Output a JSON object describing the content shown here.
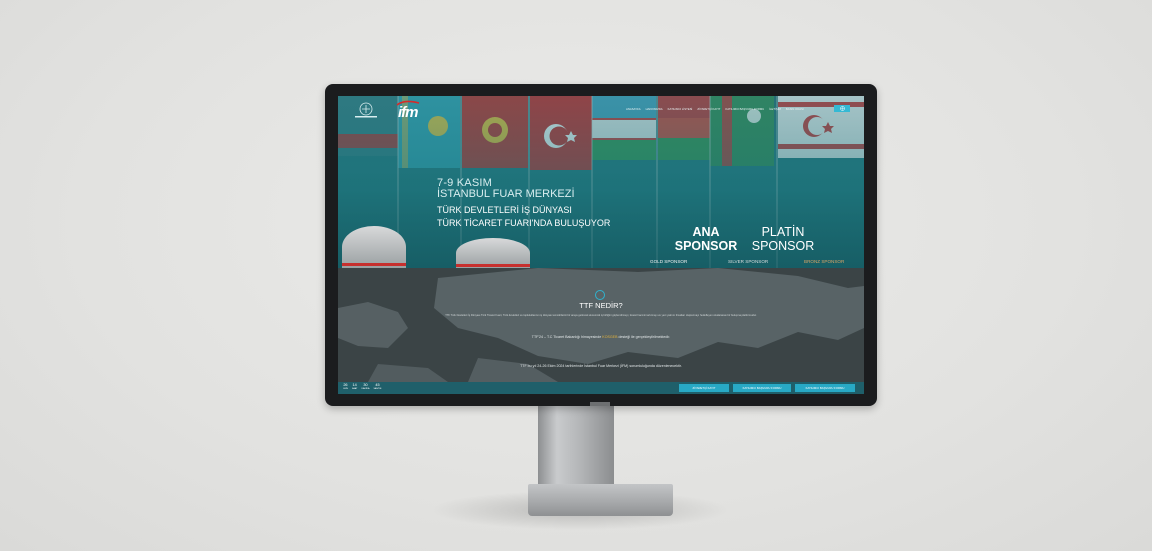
{
  "colors": {
    "background": "#e3e3e1",
    "bezel": "#1b1c1e",
    "hero_teal": "#2b7b82",
    "accent_cyan": "#28a9c5",
    "map_bg": "#3b4446",
    "highlight_gold": "#e3b23c"
  },
  "header": {
    "logo_ttf": "TTF",
    "logo_ifm": "ifm",
    "nav_links": [
      "ANASAYFA",
      "HAKKIMIZDA",
      "KATILIMCI LİSTESİ",
      "ZİYARETÇİ KAYIT",
      "KATILIMCI BAŞVURU FORMU",
      "İLETİŞİM",
      "BASIN ODASI"
    ],
    "cta_icon": "globe-icon"
  },
  "hero": {
    "line1": "7-9 KASIM",
    "line2": "İSTANBUL FUAR MERKEZİ",
    "line3": "TÜRK DEVLETLERİ İŞ DÜNYASI",
    "line4": "TÜRK TİCARET FUARI'NDA BULUŞUYOR",
    "sponsor_main_1": "ANA",
    "sponsor_main_2": "SPONSOR",
    "sponsor_plat_1": "PLATİN",
    "sponsor_plat_2": "SPONSOR",
    "sponsor_gold": "GOLD SPONSOR",
    "sponsor_silver": "SILVER SPONSOR",
    "sponsor_bronze": "BRONZ SPONSOR"
  },
  "about": {
    "title": "TTF NEDİR?",
    "paragraph": "TTF Türk Devletleri İş Dünyası Türk Ticaret Fuarı; Türk devletleri ve topluluklarının iş dünyası temsilcilerini bir araya getirerek ekonomik iş birliğini güçlendirmeyi, ticaret hacmini artırmayı ve yeni yatırım fırsatları oluşturmayı hedefleyen uluslararası bir buluşma platformudur.",
    "line1_pre": "TTF'24 – T.C Ticaret Bakanlığı himayesinde ",
    "line1_hl": "KOSGEB",
    "line1_post": " desteği ile gerçekleştirilmektedir.",
    "line2": "TTF bu yıl 24-26 Ekim 2024 tarihlerinde İstanbul Fuar Merkezi (İFM) sorumluluğunda düzenlenecektir."
  },
  "countdown": [
    {
      "num": "26",
      "label": "GÜN"
    },
    {
      "num": "14",
      "label": "SAAT"
    },
    {
      "num": "30",
      "label": "DAKİKA"
    },
    {
      "num": "45",
      "label": "SANİYE"
    }
  ],
  "bottom_buttons": [
    "ZİYARETÇİ KAYIT",
    "KATILIMCI BAŞVURU FORMU",
    "KATILIMCI BAŞVURU FORMU"
  ]
}
